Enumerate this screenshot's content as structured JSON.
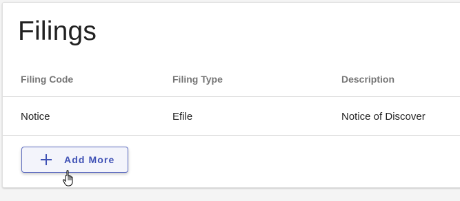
{
  "page": {
    "title": "Filings"
  },
  "table": {
    "columns": [
      "Filing Code",
      "Filing Type",
      "Description"
    ],
    "rows": [
      [
        "Notice",
        "Efile",
        "Notice of Discover"
      ]
    ]
  },
  "actions": {
    "add_more_label": "Add More",
    "add_more_icon": "plus-icon"
  },
  "cursor": {
    "icon": "hand-pointer-icon"
  },
  "colors": {
    "accent": "#3f51b5",
    "button_bg": "#f3f4fb",
    "header_text": "#757575",
    "body_text": "#212121",
    "divider": "#d6d6d6"
  }
}
